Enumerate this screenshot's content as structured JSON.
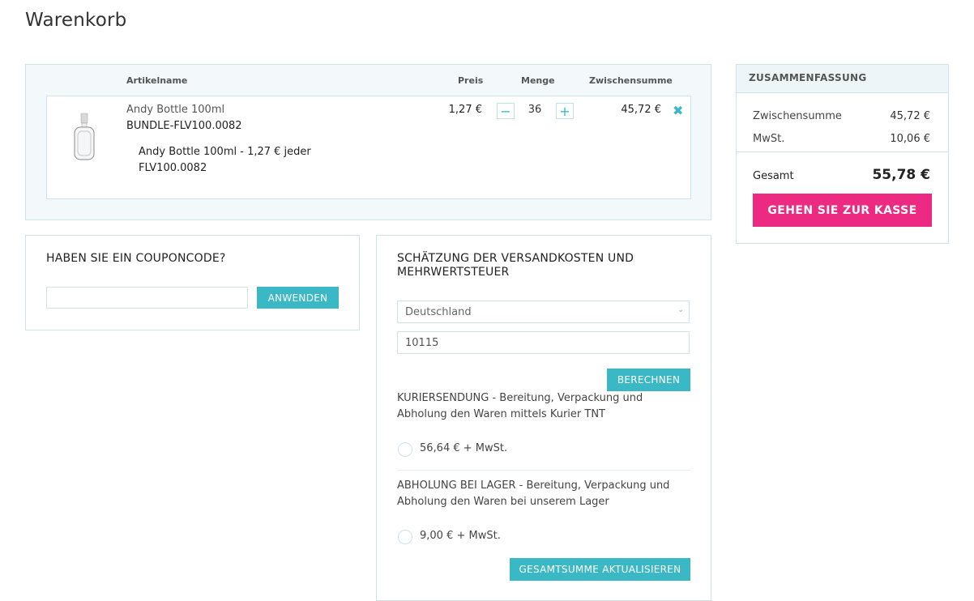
{
  "page": {
    "title": "Warenkorb"
  },
  "cart": {
    "columns": {
      "name": "Artikelname",
      "price": "Preis",
      "qty": "Menge",
      "subtotal": "Zwischensumme"
    },
    "item": {
      "name": "Andy Bottle 100ml",
      "sku": "BUNDLE-FLV100.0082",
      "bundle_line": "Andy Bottle 100ml - 1,27 € jeder FLV100.0082",
      "price": "1,27 €",
      "quantity": "36",
      "subtotal": "45,72 €",
      "decrement_label": "−",
      "increment_label": "+",
      "remove_label": "✖"
    }
  },
  "summary": {
    "title": "ZUSAMMENFASSUNG",
    "subtotal_label": "Zwischensumme",
    "subtotal_value": "45,72 €",
    "tax_label": "MwSt.",
    "tax_value": "10,06 €",
    "total_label": "Gesamt",
    "total_value": "55,78 €",
    "checkout_label": "GEHEN SIE ZUR KASSE",
    "checkout_color": "#ec2a81"
  },
  "coupon": {
    "title": "HABEN SIE EIN COUPONCODE?",
    "input_value": "",
    "apply_label": "ANWENDEN"
  },
  "shipping": {
    "title": "SCHÄTZUNG DER VERSANDKOSTEN UND MEHRWERTSTEUER",
    "country": "Deutschland",
    "postcode": "10115",
    "calculate_label": "BERECHNEN",
    "methods": [
      {
        "description": "KURIERSENDUNG - Bereitung, Verpackung und Abholung den Waren mittels Kurier TNT",
        "rate": "56,64 € + MwSt."
      },
      {
        "description": "ABHOLUNG BEI LAGER - Bereitung, Verpackung und Abholung den Waren bei unserem Lager",
        "rate": "9,00 € + MwSt."
      }
    ],
    "update_label": "GESAMTSUMME AKTUALISIEREN"
  },
  "colors": {
    "accent": "#3bb8c6",
    "border": "#cfe3e8",
    "checkout": "#ec2a81"
  }
}
